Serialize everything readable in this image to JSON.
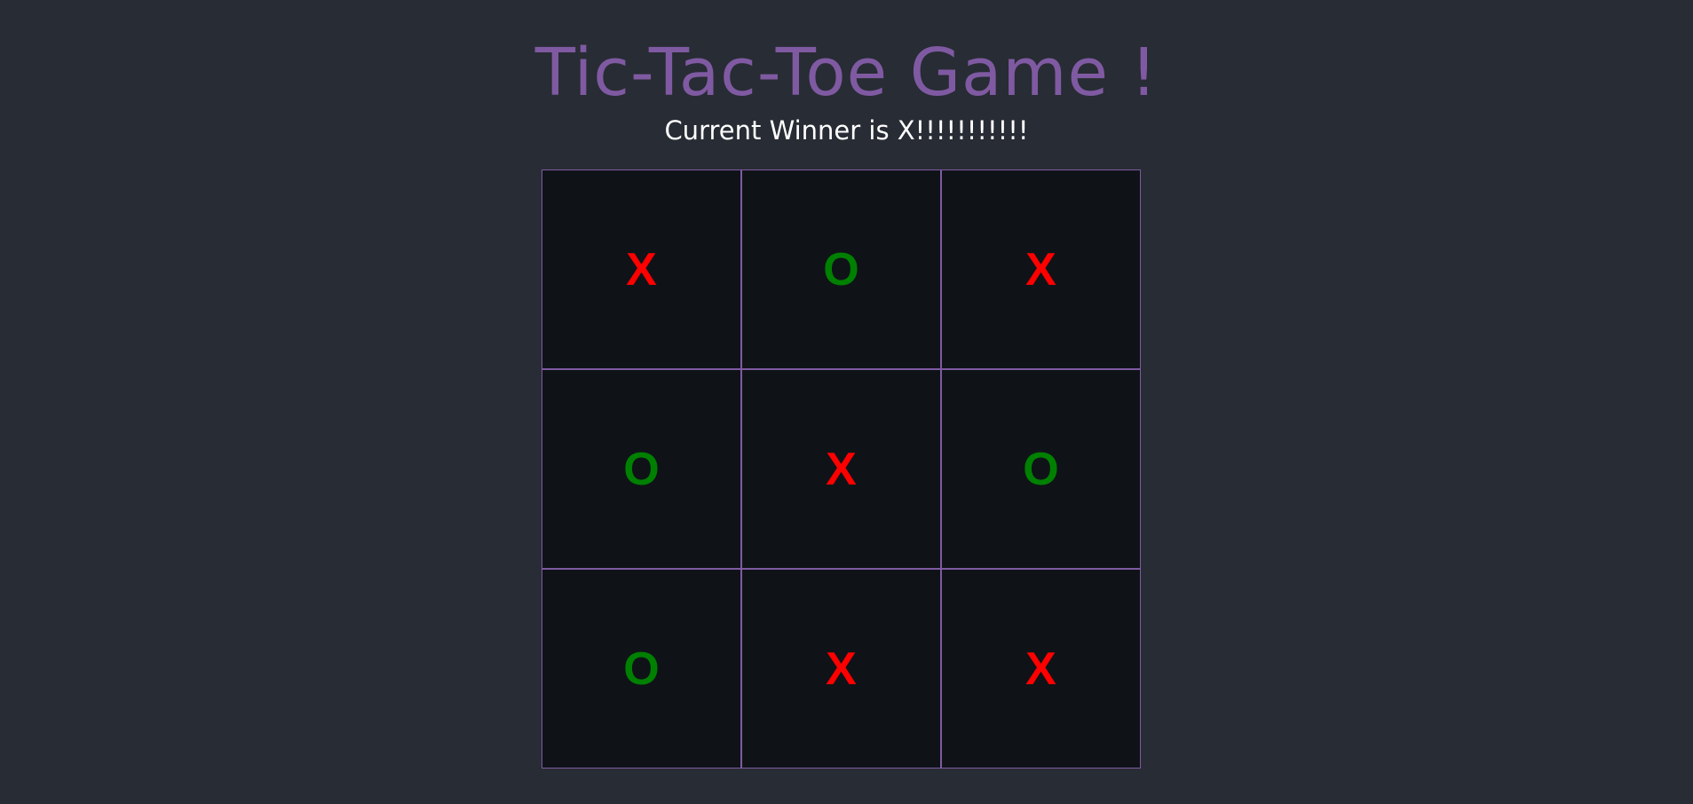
{
  "title": "Tic-Tac-Toe Game !",
  "status": "Current Winner is X!!!!!!!!!!!",
  "colors": {
    "background": "#282c34",
    "title": "#7f5aa2",
    "grid_line": "#7f5aa2",
    "cell_bg": "#0f1318",
    "x_mark": "#ff0000",
    "o_mark": "#008000"
  },
  "board": {
    "cells": [
      "X",
      "O",
      "X",
      "O",
      "X",
      "O",
      "O",
      "X",
      "X"
    ]
  }
}
